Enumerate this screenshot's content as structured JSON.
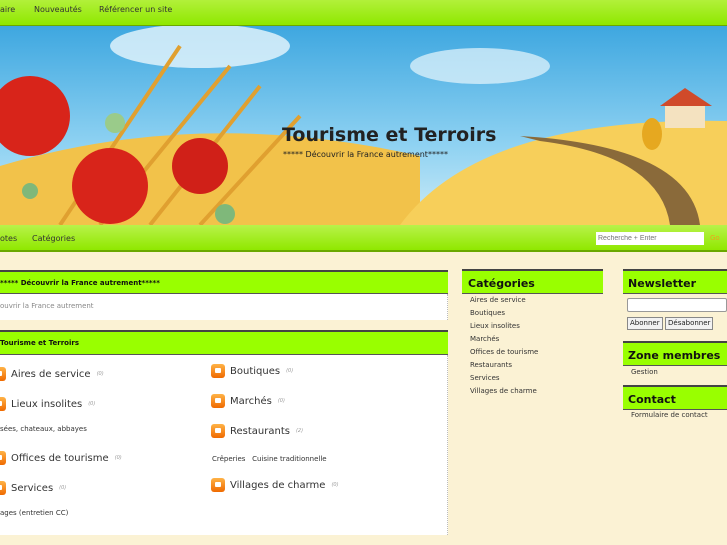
{
  "topnav": [
    "aire",
    "Nouveautés",
    "Référencer un site"
  ],
  "banner": {
    "title": "Tourisme et Terroirs",
    "subtitle": "***** Découvrir la France autrement*****"
  },
  "nav2": {
    "items": [
      "otes",
      "Catégories"
    ],
    "search_placeholder": "Recherche + Enter",
    "go": "Go"
  },
  "main": {
    "box1": {
      "title": "***** Découvrir la France autrement*****",
      "text": "ouvrir la France autrement"
    },
    "box2": {
      "title": "Tourisme et Terroirs",
      "left": [
        {
          "label": "Aires de service",
          "count": "(0)"
        },
        {
          "label": "Lieux insolites",
          "count": "(0)",
          "sub": "sées, chateaux, abbayes"
        },
        {
          "label": "Offices de tourisme",
          "count": "(0)"
        },
        {
          "label": "Services",
          "count": "(0)",
          "sub": "ages (entretien CC)"
        }
      ],
      "right": [
        {
          "label": "Boutiques",
          "count": "(0)"
        },
        {
          "label": "Marchés",
          "count": "(0)"
        },
        {
          "label": "Restaurants",
          "count": "(2)",
          "sub": "Crêperies   Cuisine traditionnelle"
        },
        {
          "label": "Villages de charme",
          "count": "(0)"
        }
      ]
    }
  },
  "categories": {
    "title": "Catégories",
    "items": [
      "Aires de service",
      "Boutiques",
      "Lieux insolites",
      "Marchés",
      "Offices de tourisme",
      "Restaurants",
      "Services",
      "Villages de charme"
    ]
  },
  "newsletter": {
    "title": "Newsletter",
    "subscribe": "Abonner",
    "unsubscribe": "Désabonner"
  },
  "members": {
    "title": "Zone membres",
    "link": "Gestion"
  },
  "contact": {
    "title": "Contact",
    "link": "Formulaire de contact"
  }
}
